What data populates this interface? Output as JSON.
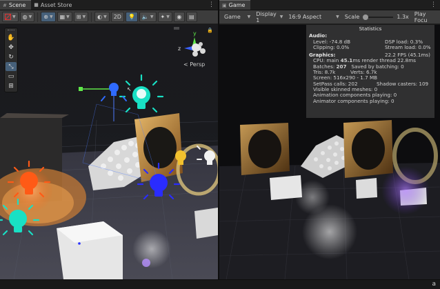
{
  "scene": {
    "tabs": [
      {
        "icon": "#",
        "label": "Scene"
      },
      {
        "icon": "■",
        "label": "Asset Store"
      }
    ],
    "toolbar": {
      "twod_label": "2D"
    },
    "gizmo": {
      "y_label": "y",
      "z_label": "z",
      "persp_label": "< Persp"
    },
    "tools": [
      {
        "name": "hand-tool",
        "glyph": "✋"
      },
      {
        "name": "move-tool",
        "glyph": "✥"
      },
      {
        "name": "rotate-tool",
        "glyph": "↻"
      },
      {
        "name": "scale-tool",
        "glyph": "⤡"
      },
      {
        "name": "rect-tool",
        "glyph": "▭"
      },
      {
        "name": "transform-tool",
        "glyph": "⊞"
      }
    ]
  },
  "game": {
    "tab_label": "Game",
    "toolbar": {
      "view_select": "Game",
      "display_select": "Display 1",
      "aspect_select": "16:9 Aspect",
      "scale_label": "Scale",
      "scale_value": "1.3x",
      "play_focus_label": "Play Focu"
    },
    "stats": {
      "title": "Statistics",
      "audio_header": "Audio:",
      "level": "Level: -74.8 dB",
      "dsp_load": "DSP load: 0.3%",
      "clipping": "Clipping: 0.0%",
      "stream_load": "Stream load: 0.0%",
      "graphics_header": "Graphics:",
      "fps": "22.2 FPS (45.1ms)",
      "cpu_main_prefix": "CPU: main ",
      "cpu_main_value": "45.1",
      "cpu_main_suffix": "ms  render thread 22.8ms",
      "batches_prefix": "Batches: ",
      "batches_value": "207",
      "saved_batching": "Saved by batching: 0",
      "tris": "Tris: 8.7k",
      "verts": "Verts: 6.7k",
      "screen": "Screen: 516x290 - 1.7 MB",
      "setpass": "SetPass calls: 202",
      "shadow_casters": "Shadow casters: 109",
      "skinned_meshes": "Visible skinned meshes: 0",
      "anim_playing": "Animation components playing: 0",
      "animator_playing": "Animator components playing: 0"
    }
  },
  "colors": {
    "accent_blue": "#46607a",
    "light_cyan": "#19e0c4",
    "light_orange": "#ff5a16",
    "light_blue": "#2a2cff",
    "gizmo_yellow": "#f2c12e",
    "panel_bg": "#3c3c3c"
  },
  "statusbar": {
    "icon": "a"
  }
}
